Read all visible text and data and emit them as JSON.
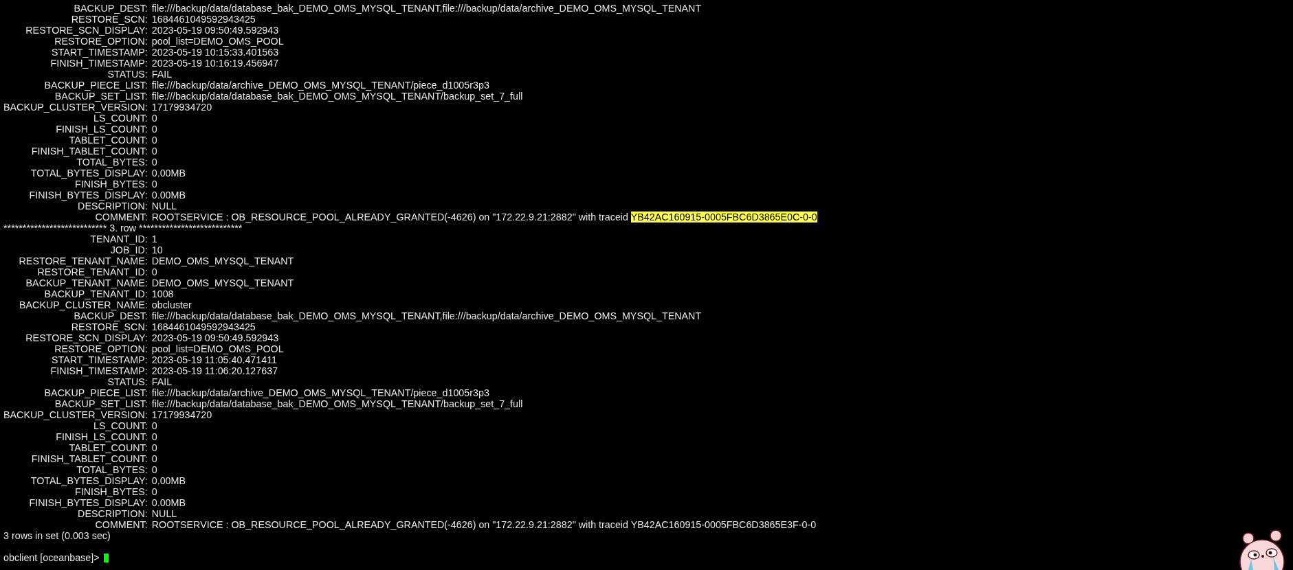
{
  "terminal": {
    "lines": [
      {
        "kind": "fields",
        "fields": [
          {
            "label": "BACKUP_DEST:",
            "value": "file:///backup/data/database_bak_DEMO_OMS_MYSQL_TENANT,file:///backup/data/archive_DEMO_OMS_MYSQL_TENANT"
          },
          {
            "label": "RESTORE_SCN:",
            "value": "1684461049592943425"
          },
          {
            "label": "RESTORE_SCN_DISPLAY:",
            "value": "2023-05-19 09:50:49.592943"
          },
          {
            "label": "RESTORE_OPTION:",
            "value": "pool_list=DEMO_OMS_POOL"
          },
          {
            "label": "START_TIMESTAMP:",
            "value": "2023-05-19 10:15:33.401563"
          },
          {
            "label": "FINISH_TIMESTAMP:",
            "value": "2023-05-19 10:16:19.456947"
          },
          {
            "label": "STATUS:",
            "value": "FAIL"
          },
          {
            "label": "BACKUP_PIECE_LIST:",
            "value": "file:///backup/data/archive_DEMO_OMS_MYSQL_TENANT/piece_d1005r3p3"
          },
          {
            "label": "BACKUP_SET_LIST:",
            "value": "file:///backup/data/database_bak_DEMO_OMS_MYSQL_TENANT/backup_set_7_full"
          },
          {
            "label": "BACKUP_CLUSTER_VERSION:",
            "value": "17179934720"
          },
          {
            "label": "LS_COUNT:",
            "value": "0"
          },
          {
            "label": "FINISH_LS_COUNT:",
            "value": "0"
          },
          {
            "label": "TABLET_COUNT:",
            "value": "0"
          },
          {
            "label": "FINISH_TABLET_COUNT:",
            "value": "0"
          },
          {
            "label": "TOTAL_BYTES:",
            "value": "0"
          },
          {
            "label": "TOTAL_BYTES_DISPLAY:",
            "value": "0.00MB"
          },
          {
            "label": "FINISH_BYTES:",
            "value": "0"
          },
          {
            "label": "FINISH_BYTES_DISPLAY:",
            "value": "0.00MB"
          },
          {
            "label": "DESCRIPTION:",
            "value": "NULL"
          },
          {
            "label": "COMMENT:",
            "value": "ROOTSERVICE : OB_RESOURCE_POOL_ALREADY_GRANTED(-4626) on \"172.22.9.21:2882\" with traceid",
            "highlight": "YB42AC160915-0005FBC6D3865E0C-0-0"
          }
        ]
      },
      {
        "kind": "text",
        "text": "*************************** 3. row ***************************"
      },
      {
        "kind": "fields",
        "fields": [
          {
            "label": "TENANT_ID:",
            "value": "1"
          },
          {
            "label": "JOB_ID:",
            "value": "10"
          },
          {
            "label": "RESTORE_TENANT_NAME:",
            "value": "DEMO_OMS_MYSQL_TENANT"
          },
          {
            "label": "RESTORE_TENANT_ID:",
            "value": "0"
          },
          {
            "label": "BACKUP_TENANT_NAME:",
            "value": "DEMO_OMS_MYSQL_TENANT"
          },
          {
            "label": "BACKUP_TENANT_ID:",
            "value": "1008"
          },
          {
            "label": "BACKUP_CLUSTER_NAME:",
            "value": "obcluster"
          },
          {
            "label": "BACKUP_DEST:",
            "value": "file:///backup/data/database_bak_DEMO_OMS_MYSQL_TENANT,file:///backup/data/archive_DEMO_OMS_MYSQL_TENANT"
          },
          {
            "label": "RESTORE_SCN:",
            "value": "1684461049592943425"
          },
          {
            "label": "RESTORE_SCN_DISPLAY:",
            "value": "2023-05-19 09:50:49.592943"
          },
          {
            "label": "RESTORE_OPTION:",
            "value": "pool_list=DEMO_OMS_POOL"
          },
          {
            "label": "START_TIMESTAMP:",
            "value": "2023-05-19 11:05:40.471411"
          },
          {
            "label": "FINISH_TIMESTAMP:",
            "value": "2023-05-19 11:06:20.127637"
          },
          {
            "label": "STATUS:",
            "value": "FAIL"
          },
          {
            "label": "BACKUP_PIECE_LIST:",
            "value": "file:///backup/data/archive_DEMO_OMS_MYSQL_TENANT/piece_d1005r3p3"
          },
          {
            "label": "BACKUP_SET_LIST:",
            "value": "file:///backup/data/database_bak_DEMO_OMS_MYSQL_TENANT/backup_set_7_full"
          },
          {
            "label": "BACKUP_CLUSTER_VERSION:",
            "value": "17179934720"
          },
          {
            "label": "LS_COUNT:",
            "value": "0"
          },
          {
            "label": "FINISH_LS_COUNT:",
            "value": "0"
          },
          {
            "label": "TABLET_COUNT:",
            "value": "0"
          },
          {
            "label": "FINISH_TABLET_COUNT:",
            "value": "0"
          },
          {
            "label": "TOTAL_BYTES:",
            "value": "0"
          },
          {
            "label": "TOTAL_BYTES_DISPLAY:",
            "value": "0.00MB"
          },
          {
            "label": "FINISH_BYTES:",
            "value": "0"
          },
          {
            "label": "FINISH_BYTES_DISPLAY:",
            "value": "0.00MB"
          },
          {
            "label": "DESCRIPTION:",
            "value": "NULL"
          },
          {
            "label": "COMMENT:",
            "value": "ROOTSERVICE : OB_RESOURCE_POOL_ALREADY_GRANTED(-4626) on \"172.22.9.21:2882\" with traceid YB42AC160915-0005FBC6D3865E3F-0-0"
          }
        ]
      },
      {
        "kind": "text",
        "text": "3 rows in set (0.003 sec)"
      },
      {
        "kind": "blank"
      },
      {
        "kind": "prompt",
        "text": "obclient [oceanbase]>",
        "cursor": true
      }
    ]
  }
}
